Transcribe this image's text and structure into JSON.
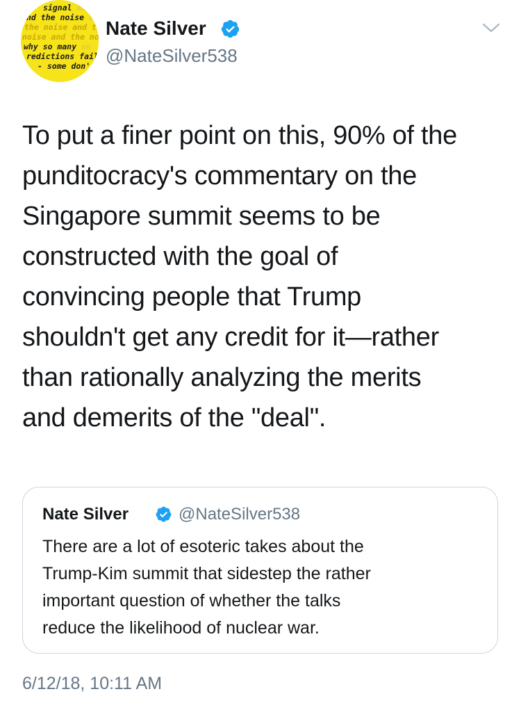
{
  "author": {
    "name": "Nate Silver",
    "handle": "@NateSilver538",
    "avatar_lines": [
      {
        "dark": "signal",
        "light": " an"
      },
      {
        "dark": "nd the noise",
        "light": " a"
      },
      {
        "mid": "the noise and th",
        "light": ""
      },
      {
        "mid": "noise and the no",
        "light": ""
      },
      {
        "dark": "why so many",
        "light": " an"
      },
      {
        "dark": "redictions fail",
        "light": "-"
      },
      {
        "dark": "- some don'",
        "light": ""
      }
    ]
  },
  "tweet": {
    "lines": [
      "To put a finer point on this, 90% of the",
      "punditocracy's commentary on the",
      "Singapore summit seems to be",
      "constructed with the goal of",
      "convincing people that Trump",
      "shouldn't get any credit for it—rather",
      "than rationally analyzing the merits",
      "and demerits of the \"deal\"."
    ],
    "timestamp": "6/12/18, 10:11 AM"
  },
  "quoted_tweet": {
    "name": "Nate Silver",
    "handle": "@NateSilver538",
    "lines": [
      "There are a lot of esoteric takes about the",
      "Trump-Kim summit that sidestep the rather",
      "important question of whether the talks",
      "reduce the likelihood of nuclear war."
    ]
  },
  "icons": {
    "verified": "verified-badge-icon",
    "menu": "chevron-down-icon"
  },
  "colors": {
    "verified_blue": "#1da1f2",
    "secondary_text": "#657786",
    "border": "#ccd6dd",
    "avatar_yellow": "#f6e31a"
  }
}
